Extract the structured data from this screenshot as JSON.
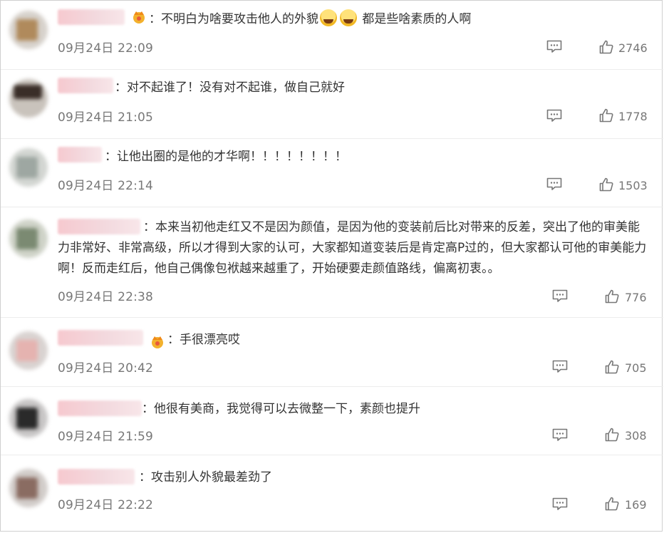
{
  "comments": [
    {
      "text": "：不明白为啥要攻击他人的外貌",
      "text_after_emoji": "都是些啥素质的人啊",
      "time": "09月24日 22:09",
      "likes": "2746"
    },
    {
      "text": "：对不起谁了！没有对不起谁，做自己就好",
      "time": "09月24日 21:05",
      "likes": "1778"
    },
    {
      "text": "：让他出圈的是他的才华啊！！！！！！！！",
      "time": "09月24日 22:14",
      "likes": "1503"
    },
    {
      "text": "：本来当初他走红又不是因为颜值，是因为他的变装前后比对带来的反差，突出了他的审美能力非常好、非常高级，所以才得到大家的认可，大家都知道变装后是肯定高P过的，但大家都认可他的审美能力啊！反而走红后，他自己偶像包袱越来越重了，开始硬要走颜值路线，偏离初衷。。",
      "time": "09月24日 22:38",
      "likes": "776"
    },
    {
      "text": "：手很漂亮哎",
      "time": "09月24日 20:42",
      "likes": "705"
    },
    {
      "text": "：他很有美商，我觉得可以去微整一下，素颜也提升",
      "time": "09月24日 21:59",
      "likes": "308"
    },
    {
      "text": "：攻击别人外貌最差劲了",
      "time": "09月24日 22:22",
      "likes": "169"
    }
  ],
  "icons": {
    "vip": "crown-icon",
    "emoji": "laughing-tears-emoji-icon",
    "reply": "comment-bubble-icon",
    "like": "thumbs-up-icon"
  }
}
